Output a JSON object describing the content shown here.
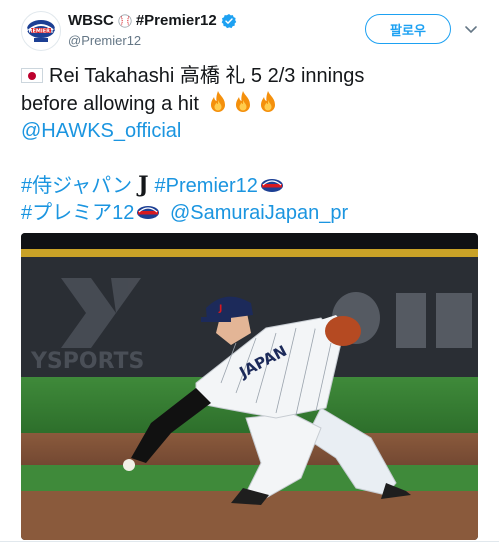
{
  "header": {
    "display_name": "WBSC",
    "hashtag_name": "#Premier12",
    "handle": "@Premier12",
    "follow_label": "팔로우",
    "verified": true
  },
  "tweet": {
    "line1_text": "Rei Takahashi 高橋 礼  5 2/3 innings",
    "line2_text": "before allowing a hit",
    "mention": "@HAWKS_official",
    "tag1": "#侍ジャパン",
    "j_mark": "J",
    "tag2": "#Premier12",
    "tag3": "#プレミア12",
    "mention2": "@SamuraiJapan_pr",
    "emojis": [
      "fire-icon",
      "fire-icon",
      "fire-icon"
    ]
  },
  "photo": {
    "banner_text": "YSPORTS",
    "jersey_text": "JAPAN"
  },
  "colors": {
    "link": "#1b95e0",
    "follow": "#1da1f2",
    "text": "#14171a",
    "muted": "#657786"
  }
}
